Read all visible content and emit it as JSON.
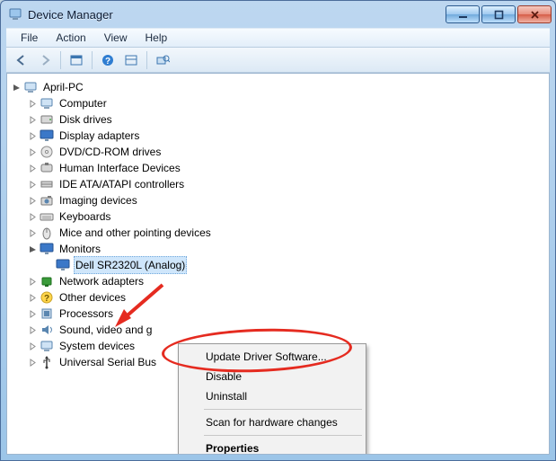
{
  "window": {
    "title": "Device Manager"
  },
  "menu": {
    "file": "File",
    "action": "Action",
    "view": "View",
    "help": "Help"
  },
  "tree": {
    "root": "April-PC",
    "items": [
      "Computer",
      "Disk drives",
      "Display adapters",
      "DVD/CD-ROM drives",
      "Human Interface Devices",
      "IDE ATA/ATAPI controllers",
      "Imaging devices",
      "Keyboards",
      "Mice and other pointing devices"
    ],
    "monitors_label": "Monitors",
    "monitors_child": "Dell SR2320L (Analog)",
    "after": [
      "Network adapters",
      "Other devices",
      "Processors",
      "Sound, video and g",
      "System devices",
      "Universal Serial Bus"
    ]
  },
  "context": {
    "update": "Update Driver Software...",
    "disable": "Disable",
    "uninstall": "Uninstall",
    "scan": "Scan for hardware changes",
    "properties": "Properties"
  }
}
